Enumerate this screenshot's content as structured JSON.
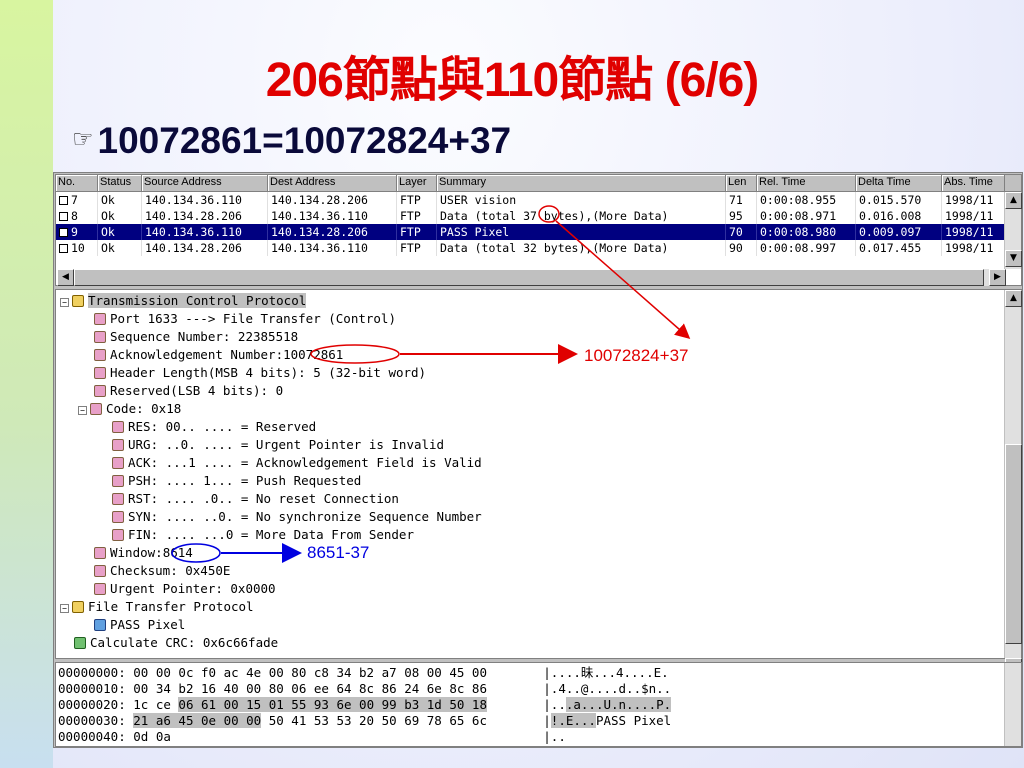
{
  "slide": {
    "title": "206節點與110節點 (6/6)",
    "bullet_icon": "pointing-hand-icon",
    "bullet_text": "10072861=10072824+37"
  },
  "packet_list": {
    "columns": [
      "No.",
      "Status",
      "Source Address",
      "Dest Address",
      "Layer",
      "Summary",
      "Len",
      "Rel. Time",
      "Delta Time",
      "Abs. Time"
    ],
    "rows": [
      {
        "no": "7",
        "status": "Ok",
        "src": "140.134.36.110",
        "dst": "140.134.28.206",
        "layer": "FTP",
        "summary": "USER vision",
        "len": "71",
        "rel": "0:00:08.955",
        "delta": "0.015.570",
        "abs": "1998/11",
        "selected": false
      },
      {
        "no": "8",
        "status": "Ok",
        "src": "140.134.28.206",
        "dst": "140.134.36.110",
        "layer": "FTP",
        "summary": "Data (total 37 bytes),(More Data)",
        "len": "95",
        "rel": "0:00:08.971",
        "delta": "0.016.008",
        "abs": "1998/11",
        "selected": false
      },
      {
        "no": "9",
        "status": "Ok",
        "src": "140.134.36.110",
        "dst": "140.134.28.206",
        "layer": "FTP",
        "summary": "PASS Pixel",
        "len": "70",
        "rel": "0:00:08.980",
        "delta": "0.009.097",
        "abs": "1998/11",
        "selected": true
      },
      {
        "no": "10",
        "status": "Ok",
        "src": "140.134.28.206",
        "dst": "140.134.36.110",
        "layer": "FTP",
        "summary": "Data (total 32 bytes),(More Data)",
        "len": "90",
        "rel": "0:00:08.997",
        "delta": "0.017.455",
        "abs": "1998/11",
        "selected": false
      }
    ]
  },
  "tree": {
    "tcp": "Transmission Control Protocol",
    "port": "Port 1633 ---> File Transfer (Control)",
    "seq": "Sequence Number: 22385518",
    "ack_label": "Acknowledgement Number:",
    "ack_value": "10072861",
    "hlen": "Header Length(MSB 4 bits): 5 (32-bit word)",
    "reserved": "Reserved(LSB 4 bits): 0",
    "code": "Code: 0x18",
    "res": "RES: 00.. .... = Reserved",
    "urg": "URG: ..0. .... = Urgent Pointer is Invalid",
    "ackf": "ACK: ...1 .... = Acknowledgement Field is Valid",
    "psh": "PSH: .... 1... = Push Requested",
    "rst": "RST: .... .0.. = No reset Connection",
    "syn": "SYN: .... ..0. = No synchronize Sequence Number",
    "fin": "FIN: .... ...0 = More Data From Sender",
    "window_label": "Window:",
    "window_value": "8614",
    "checksum": "Checksum: 0x450E",
    "urgent": "Urgent Pointer: 0x0000",
    "ftp": "File Transfer Protocol",
    "pass": "PASS Pixel",
    "crc": "Calculate CRC: 0x6c66fade"
  },
  "hex": [
    {
      "off": "00000000:",
      "bytes_a": "00 00 0c f0 ac 4e 00 80 c8 34 b2 a7 08 00 45 00",
      "bytes_b": "",
      "bytes_c": "",
      "ascii_a": "|....昧...4....E.",
      "ascii_b": "",
      "ascii_c": ""
    },
    {
      "off": "00000010:",
      "bytes_a": "00 34 b2 16 40 00 80 06 ee 64 8c 86 24 6e 8c 86",
      "bytes_b": "",
      "bytes_c": "",
      "ascii_a": "|.4..@....d..$n..",
      "ascii_b": "",
      "ascii_c": ""
    },
    {
      "off": "00000020:",
      "bytes_a": "1c ce ",
      "bytes_b": "06 61 00 15 01 55 93 6e 00 99 b3 1d 50 18",
      "bytes_c": "",
      "ascii_a": "|..",
      "ascii_b": ".a...U.n....P.",
      "ascii_c": ""
    },
    {
      "off": "00000030:",
      "bytes_a": "",
      "bytes_b": "21 a6 45 0e 00 00",
      "bytes_c": " 50 41 53 53 20 50 69 78 65 6c",
      "ascii_a": "|",
      "ascii_b": "!.E...",
      "ascii_c": "PASS Pixel"
    },
    {
      "off": "00000040:",
      "bytes_a": "0d 0a",
      "bytes_b": "",
      "bytes_c": "",
      "ascii_a": "|..",
      "ascii_b": "",
      "ascii_c": ""
    }
  ],
  "annotations": {
    "ack_calc": "10072824+37",
    "window_calc": "8651-37"
  },
  "colors": {
    "title": "#e00000",
    "selection": "#000080",
    "annotation_red": "#e00000",
    "annotation_blue": "#0000e0"
  }
}
